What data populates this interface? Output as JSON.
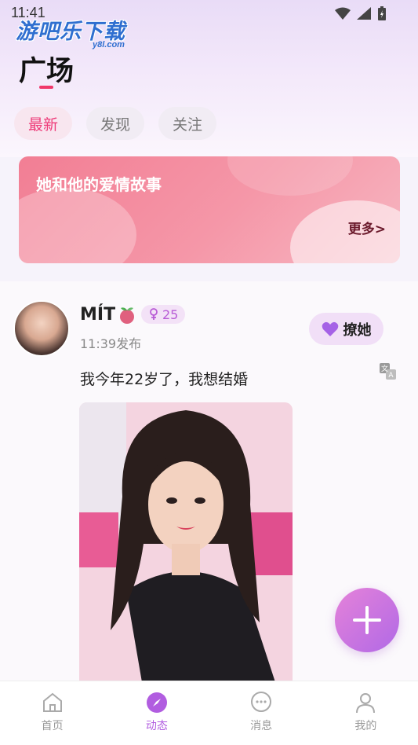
{
  "status_bar": {
    "time": "11:41"
  },
  "watermark": {
    "text": "游吧乐下载",
    "sub": "y8l.com"
  },
  "header": {
    "title": "广场"
  },
  "tabs": [
    {
      "label": "最新",
      "active": true
    },
    {
      "label": "发现",
      "active": false
    },
    {
      "label": "关注",
      "active": false
    }
  ],
  "banner": {
    "title": "她和他的爱情故事",
    "more": "更多>"
  },
  "post": {
    "username": "MÍT",
    "age": "25",
    "time": "11:39发布",
    "action_label": "撩她",
    "text": "我今年22岁了，我想结婚"
  },
  "nav": {
    "items": [
      {
        "label": "首页",
        "icon": "home-icon"
      },
      {
        "label": "动态",
        "icon": "compass-icon",
        "active": true
      },
      {
        "label": "消息",
        "icon": "chat-icon"
      },
      {
        "label": "我的",
        "icon": "person-icon"
      }
    ]
  },
  "colors": {
    "accent": "#b15de0",
    "tab_active": "#ee3d7a",
    "banner": "#f27e94"
  }
}
